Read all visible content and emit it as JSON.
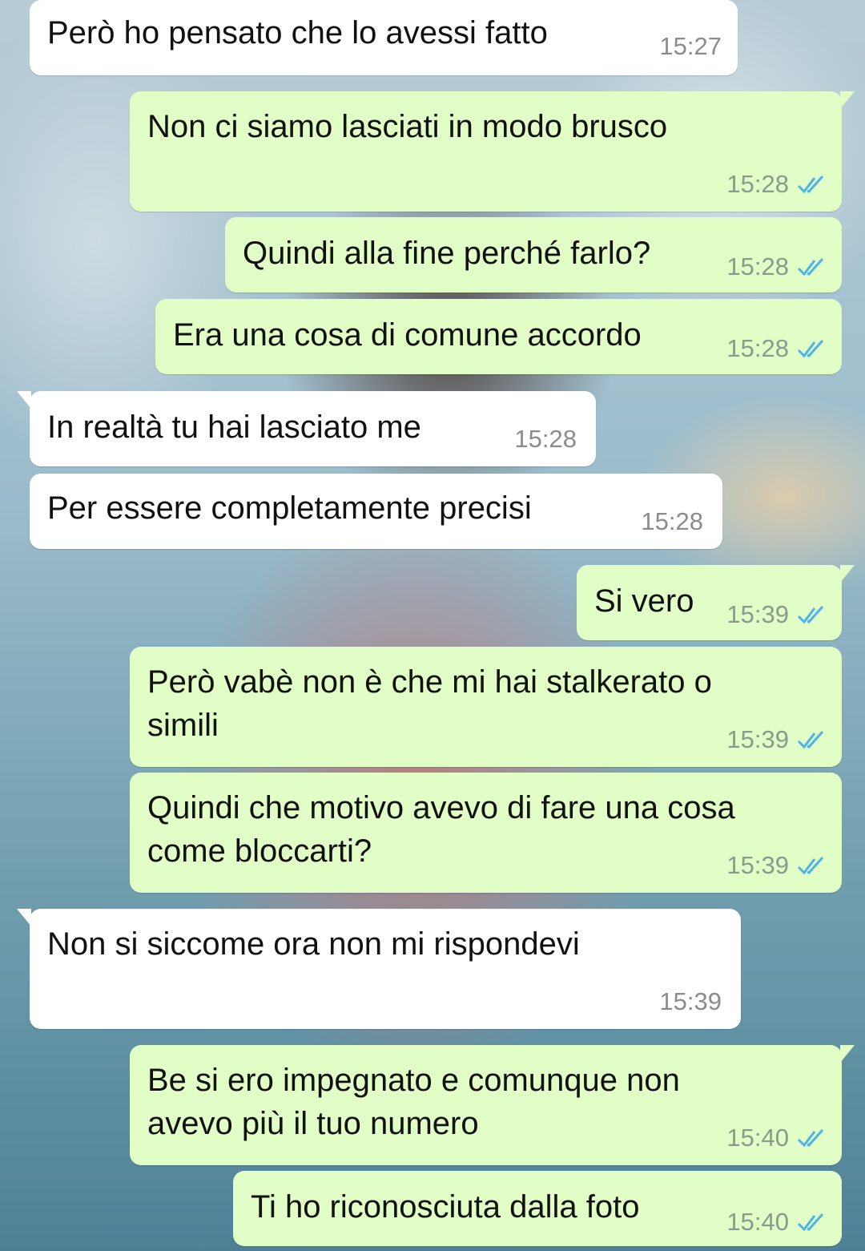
{
  "messages": [
    {
      "direction": "in",
      "text": "Però ho pensato che lo avessi fatto",
      "time": "15:27"
    },
    {
      "direction": "out",
      "text": "Non ci siamo lasciati in modo brusco",
      "time": "15:28",
      "status": "read"
    },
    {
      "direction": "out",
      "text": "Quindi alla fine perché farlo?",
      "time": "15:28",
      "status": "read"
    },
    {
      "direction": "out",
      "text": "Era una cosa di comune accordo",
      "time": "15:28",
      "status": "read"
    },
    {
      "direction": "in",
      "text": "In realtà tu hai lasciato me",
      "time": "15:28"
    },
    {
      "direction": "in",
      "text": "Per essere completamente precisi",
      "time": "15:28"
    },
    {
      "direction": "out",
      "text": "Si vero",
      "time": "15:39",
      "status": "read"
    },
    {
      "direction": "out",
      "text": "Però vabè non è che mi hai stalkerato o\nsimili",
      "time": "15:39",
      "status": "read"
    },
    {
      "direction": "out",
      "text": "Quindi che motivo avevo di fare una cosa\ncome bloccarti?",
      "time": "15:39",
      "status": "read"
    },
    {
      "direction": "in",
      "text": "Non si siccome ora non mi rispondevi",
      "time": "15:39"
    },
    {
      "direction": "out",
      "text": "Be si ero impegnato e comunque non\navevo più il tuo numero",
      "time": "15:40",
      "status": "read"
    },
    {
      "direction": "out",
      "text": "Ti ho riconosciuta dalla foto",
      "time": "15:40",
      "status": "read"
    }
  ],
  "colors": {
    "incoming_bubble": "#ffffff",
    "outgoing_bubble": "#e1fec6",
    "read_check": "#4fb3e8",
    "timestamp": "#8a9a8f"
  },
  "icons": {
    "read_status": "double-check-icon"
  }
}
